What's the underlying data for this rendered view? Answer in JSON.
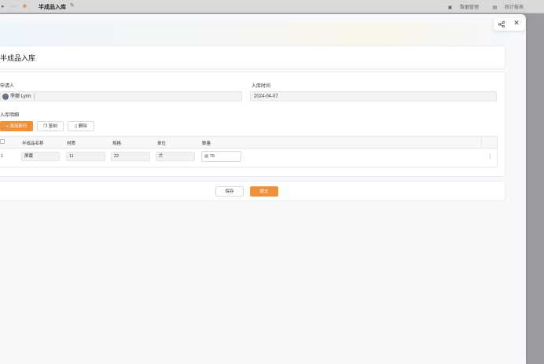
{
  "topbar": {
    "more_glyph": "···",
    "app_title": "半成品入库",
    "links": [
      "数据管理",
      "统计报表"
    ]
  },
  "drawer": {
    "title": "半成品入库",
    "form": {
      "applicant_label": "申请人",
      "applicant_value": "李娜 Lynn",
      "time_label": "入库时间",
      "time_value": "2024-04-07",
      "detail_label": "入库明细"
    },
    "toolbar": {
      "add_label": "+ 添加新行",
      "copy_label": "复制",
      "delete_label": "删除"
    },
    "table": {
      "columns": [
        "半成品名称",
        "材质",
        "规格",
        "单位",
        "数量"
      ],
      "rows": [
        {
          "index": "1",
          "name": "屏幕",
          "material": "11",
          "spec": "22",
          "unit": "片",
          "qty": "79"
        }
      ]
    },
    "footer": {
      "save_label": "保存",
      "submit_label": "提交"
    }
  },
  "colors": {
    "primary": "#f0913a",
    "overlay": "#9a9c9f"
  },
  "icons": [
    "share-icon",
    "close-icon",
    "copy-icon",
    "trash-icon",
    "more-icon",
    "calculator-icon"
  ]
}
